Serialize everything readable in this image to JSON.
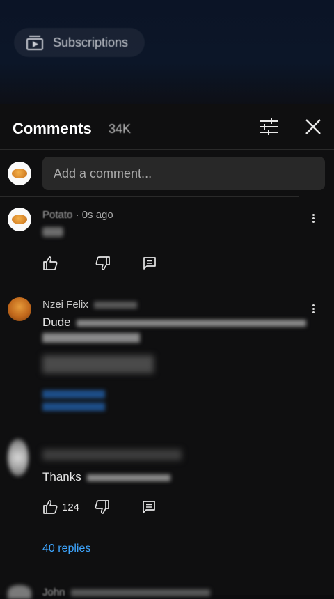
{
  "background_top": {
    "subscriptions_label": "Subscriptions"
  },
  "comments_header": {
    "title": "Comments",
    "count": "34K"
  },
  "composer": {
    "placeholder": "Add a comment..."
  },
  "comments": [
    {
      "author": "Potato",
      "time": "· 0s ago",
      "text": "",
      "likes": ""
    },
    {
      "author": "Nzei Felix",
      "time": "",
      "text": "Dude",
      "likes": "",
      "replies": ""
    },
    {
      "author": "",
      "time": "",
      "text": "Thanks",
      "likes": "124",
      "replies": "40 replies"
    },
    {
      "author": "John",
      "time": "",
      "text": ""
    }
  ],
  "colors": {
    "panel_bg": "#0f0f10",
    "accent_link": "#3ea6ff",
    "input_bg": "#282828"
  }
}
